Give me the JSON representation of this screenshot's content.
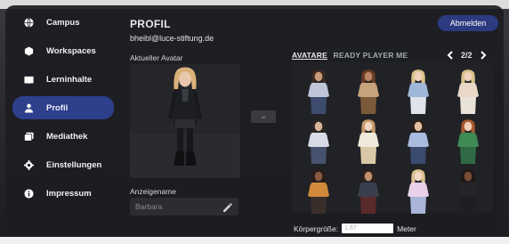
{
  "sidebar": {
    "items": [
      {
        "label": "Campus",
        "icon": "globe-icon"
      },
      {
        "label": "Workspaces",
        "icon": "hexagon-icon"
      },
      {
        "label": "Lerninhalte",
        "icon": "book-icon"
      },
      {
        "label": "Profil",
        "icon": "person-icon",
        "active": true
      },
      {
        "label": "Mediathek",
        "icon": "media-icon"
      },
      {
        "label": "Einstellungen",
        "icon": "gear-icon"
      },
      {
        "label": "Impressum",
        "icon": "info-icon"
      }
    ]
  },
  "header": {
    "title": "PROFIL",
    "email": "bheibl@luce-stiftung.de",
    "logout_label": "Abmelden"
  },
  "avatar": {
    "current_label": "Aktueller Avatar"
  },
  "display_name": {
    "label": "Anzeigename",
    "value": "Barbara"
  },
  "catalog": {
    "tabs": [
      {
        "label": "AVATARE",
        "active": true
      },
      {
        "label": "READY PLAYER ME",
        "active": false
      }
    ],
    "page": "2/2",
    "avatars": [
      {
        "hair": "#3b2a22",
        "top": "#bfc6d8",
        "bottom": "#3d4c6e",
        "skin": "#c89a7a"
      },
      {
        "hair": "#6b3b22",
        "top": "#c8a27a",
        "bottom": "#7a5a3a",
        "skin": "#b98566"
      },
      {
        "hair": "#d9c38a",
        "top": "#9fb7d8",
        "bottom": "#dfe3ea",
        "skin": "#f0d2bc"
      },
      {
        "hair": "#d8c18c",
        "top": "#e9d8c8",
        "bottom": "#e9e2d8",
        "skin": "#f1d4be"
      },
      {
        "hair": "#2b2321",
        "top": "#d7dbe6",
        "bottom": "#47536e",
        "skin": "#d8b49a"
      },
      {
        "hair": "#c69a6a",
        "top": "#f0eada",
        "bottom": "#d9c8a8",
        "skin": "#f2d6c0"
      },
      {
        "hair": "#2b1e1a",
        "top": "#a9bce0",
        "bottom": "#3a4a70",
        "skin": "#e3bda2"
      },
      {
        "hair": "#a85a2e",
        "top": "#3f8a55",
        "bottom": "#2f6a44",
        "skin": "#f0cdb4"
      },
      {
        "hair": "#2a1c18",
        "top": "#d08a3a",
        "bottom": "#3a2e2a",
        "skin": "#8a5a40"
      },
      {
        "hair": "#2c201b",
        "top": "#3a3f4d",
        "bottom": "#5b2a2a",
        "skin": "#c0906e"
      },
      {
        "hair": "#d9c090",
        "top": "#e7d0e8",
        "bottom": "#a8b4d8",
        "skin": "#f2d8c4"
      },
      {
        "hair": "#1f1714",
        "top": "#23252b",
        "bottom": "#1d1f24",
        "skin": "#7a4e36"
      }
    ]
  },
  "height": {
    "label": "Körpergröße:",
    "placeholder": "1,67",
    "unit": "Meter"
  },
  "colors": {
    "accent": "#2e3f8c",
    "panel": "#1c1d22"
  }
}
